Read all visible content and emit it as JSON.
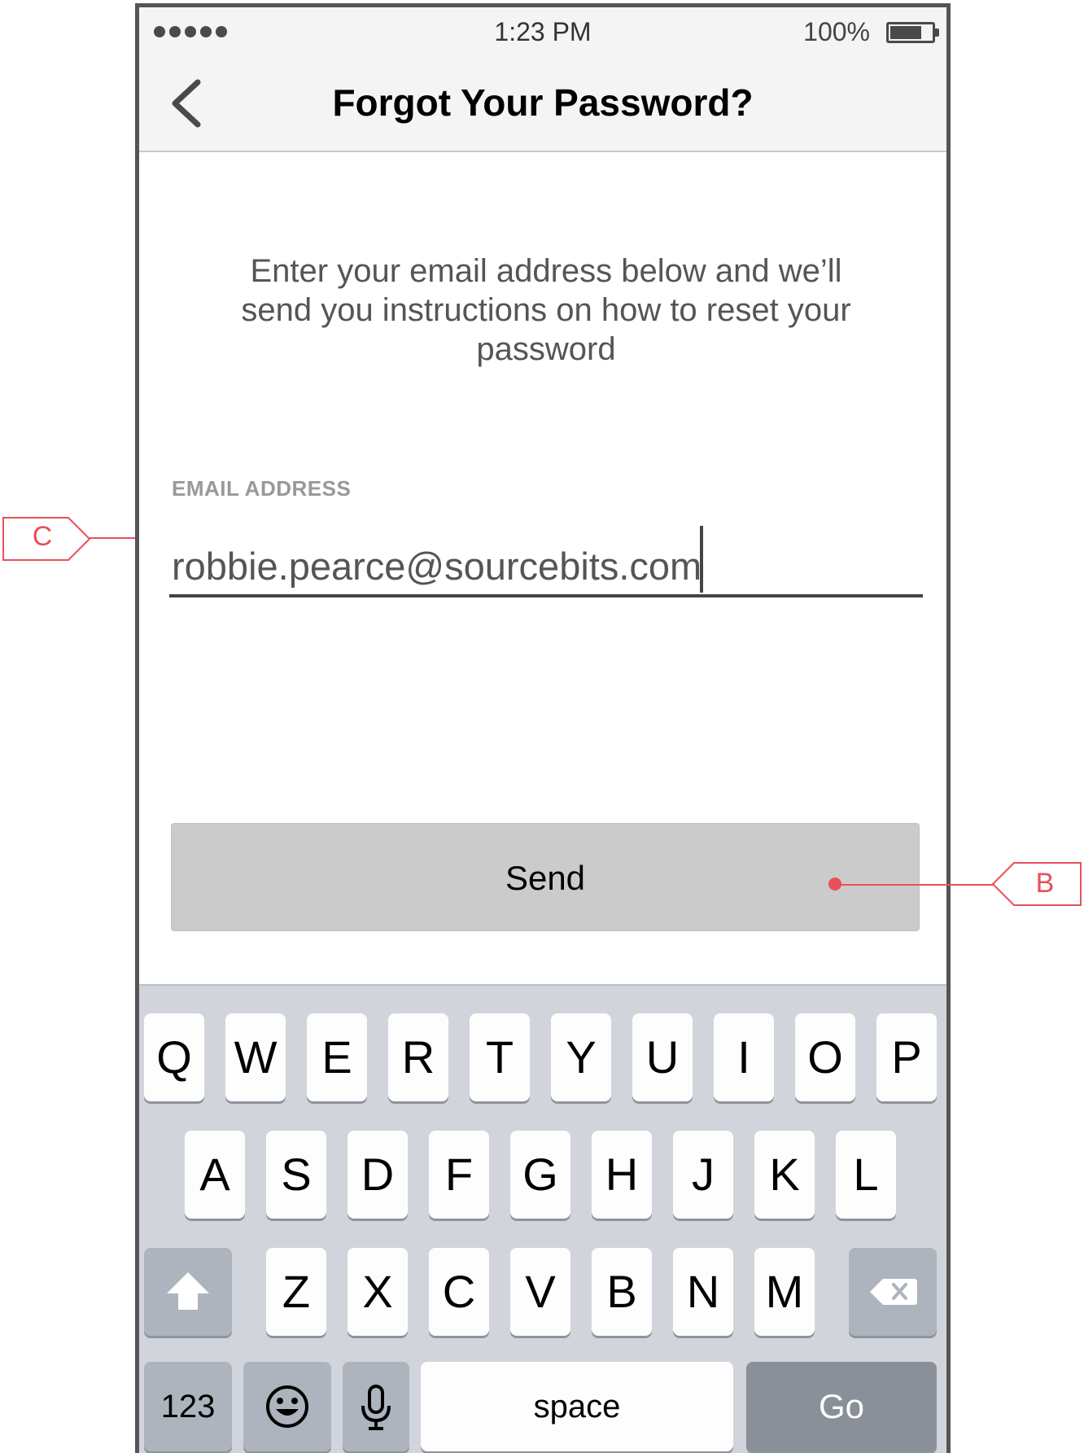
{
  "status_bar": {
    "time": "1:23 PM",
    "battery": "100%"
  },
  "nav": {
    "title": "Forgot Your Password?"
  },
  "instructions": "Enter your email address below and we’ll send you instructions on how to reset your password",
  "email": {
    "label": "EMAIL ADDRESS",
    "value": "robbie.pearce@sourcebits.com"
  },
  "send_button": {
    "label": "Send"
  },
  "keyboard": {
    "row1": [
      "Q",
      "W",
      "E",
      "R",
      "T",
      "Y",
      "U",
      "I",
      "O",
      "P"
    ],
    "row2": [
      "A",
      "S",
      "D",
      "F",
      "G",
      "H",
      "J",
      "K",
      "L"
    ],
    "row3": [
      "Z",
      "X",
      "C",
      "V",
      "B",
      "N",
      "M"
    ],
    "num_key": "123",
    "space_key": "space",
    "go_key": "Go"
  },
  "annotations": {
    "c_label": "C",
    "b_label": "B"
  },
  "colors": {
    "annotation": "#e8505b",
    "send_bg": "#cbcbcb",
    "keyboard_bg": "#d1d5db"
  },
  "icons": [
    "signal-dots-icon",
    "battery-icon",
    "back-chevron-icon",
    "shift-icon",
    "delete-icon",
    "emoji-icon",
    "microphone-icon"
  ]
}
